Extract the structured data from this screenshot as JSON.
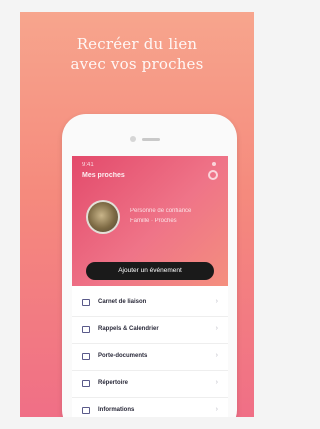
{
  "headline": {
    "line1": "Recréer du lien",
    "line2": "avec vos proches"
  },
  "app": {
    "status_text": "9:41",
    "title": "Mes proches",
    "profile_line1": "Personne de confiance",
    "profile_line2": "Famille · Proches",
    "add_event_button": "Ajouter un événement"
  },
  "menu": [
    {
      "label": "Carnet de liaison",
      "icon": "notebook-icon"
    },
    {
      "label": "Rappels & Calendrier",
      "icon": "calendar-icon"
    },
    {
      "label": "Porte-documents",
      "icon": "folder-icon"
    },
    {
      "label": "Répertoire",
      "icon": "contacts-icon"
    },
    {
      "label": "Informations",
      "icon": "info-icon"
    }
  ]
}
